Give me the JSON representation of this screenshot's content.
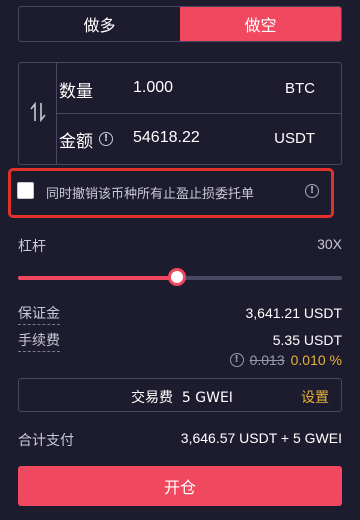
{
  "tabs": [
    {
      "label": "做多",
      "active": false
    },
    {
      "label": "做空",
      "active": true
    }
  ],
  "quantity": {
    "label": "数量",
    "value": "1.000",
    "unit": "BTC"
  },
  "amount": {
    "label": "金额",
    "value": "54618.22",
    "unit": "USDT"
  },
  "cancel_orders": {
    "label": "同时撤销该币种所有止盈止损委托单",
    "checked": false
  },
  "leverage": {
    "label": "杠杆",
    "value": "30X",
    "slider_fraction": 0.49
  },
  "margin": {
    "label": "保证金",
    "value": "3,641.21 USDT"
  },
  "fee": {
    "label": "手续费",
    "value": "5.35 USDT",
    "old_rate": "0.013",
    "new_rate": "0.010 %"
  },
  "gas": {
    "text": "交易费  5 GWEI",
    "settings_label": "设置"
  },
  "total": {
    "label": "合计支付",
    "value": "3,646.57 USDT + 5 GWEI"
  },
  "open_button": "开仓",
  "colors": {
    "accent": "#f0485f",
    "gold": "#e6b13a",
    "background": "#1d1b2e",
    "highlight_frame": "#e0322b"
  }
}
